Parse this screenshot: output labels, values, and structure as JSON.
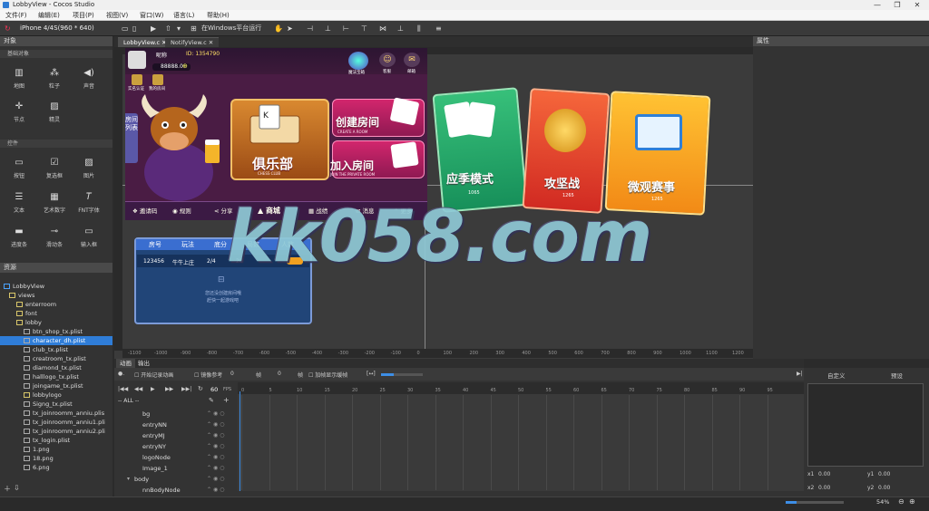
{
  "window": {
    "title": "LobbyView - Cocos Studio",
    "min": "—",
    "max": "❐",
    "close": "✕"
  },
  "menu": [
    "文件(F)",
    "编辑(E)",
    "项目(P)",
    "视图(V)",
    "窗口(W)",
    "语言(L)",
    "帮助(H)"
  ],
  "toolbar": {
    "device": "iPhone 4/4S(960 * 640)",
    "run_label": "在Windows平台运行"
  },
  "panels": {
    "objects": "对象",
    "resources": "资源",
    "properties": "属性"
  },
  "objects": {
    "basic_section": "基础对象",
    "basic": [
      "地图",
      "粒子",
      "声音",
      "节点",
      "精灵"
    ],
    "controls_section": "控件",
    "controls": [
      "按钮",
      "复选框",
      "图片",
      "文本",
      "艺术数字",
      "FNT字体",
      "进度条",
      "滑动条",
      "输入框"
    ]
  },
  "resources": {
    "root": "LobbyView",
    "items": [
      "views",
      "enterroom",
      "font",
      "lobby",
      "btn_shop_tx.plist",
      "character_dh.plist",
      "club_tx.plist",
      "creatroom_tx.plist",
      "diamond_tx.plist",
      "halllogo_tx.plist",
      "joingame_tx.plist",
      "lobbylogo",
      "Signg_tx.plist",
      "tx_joinroomm_anniu.plis",
      "tx_joinroomm_anniu1.pli",
      "tx_joinroomm_anniu2.pli",
      "tx_login.plist",
      "1.png",
      "18.png",
      "6.png"
    ]
  },
  "tabs": [
    "LobbyView.c",
    "NotifyView.c"
  ],
  "ruler_bottom": [
    "-1100",
    "-1000",
    "-900",
    "-800",
    "-700",
    "-600",
    "-500",
    "-400",
    "-300",
    "-200",
    "-100",
    "0",
    "100",
    "200",
    "300",
    "400",
    "500",
    "600",
    "700",
    "800",
    "900",
    "1000",
    "1100",
    "1200"
  ],
  "scene": {
    "player_name": "昵称",
    "player_id": "ID: 1354790",
    "coins": "88888.0",
    "top_icons": [
      "魔法宝箱",
      "客服",
      "邮箱"
    ],
    "left_icons": [
      "实名认证",
      "我的房间"
    ],
    "room_list": "房间列表",
    "club_title": "俱乐部",
    "club_sub": "CHESS CLUB",
    "create_title": "创建房间",
    "create_sub": "CREATE A ROOM",
    "join_title": "加入房间",
    "join_sub": "JOIN THE PRIVATE ROOM",
    "bottom": [
      "邀请码",
      "规则",
      "分享",
      "商城",
      "战绩",
      "消息",
      "更多"
    ]
  },
  "room_table": {
    "headers": [
      "房号",
      "玩法",
      "底分",
      "局数",
      "人数"
    ],
    "row": [
      "123456",
      "牛牛上庄",
      "2/4",
      "20"
    ],
    "empty": "您还没创建房间哦",
    "empty2": "赶快一起游戏吧"
  },
  "modes": [
    {
      "title": "应季模式",
      "count": "1065"
    },
    {
      "title": "攻坚战",
      "count": "1265"
    },
    {
      "title": "微观赛事",
      "count": "1265"
    }
  ],
  "watermark": "kk058.com",
  "anim": {
    "tabs": [
      "动画",
      "输出"
    ],
    "record": "开始记录动画",
    "onion": "镜像参考",
    "labels": [
      "帧",
      "帧"
    ],
    "values": [
      "0",
      "0"
    ],
    "interp": "加帧显示缓帧",
    "filter": "-- ALL --",
    "fps": "60",
    "fps_unit": "FPS",
    "ticks": [
      "0",
      "5",
      "10",
      "15",
      "20",
      "25",
      "30",
      "35",
      "40",
      "45",
      "50",
      "55",
      "60",
      "65",
      "70",
      "75",
      "80",
      "85",
      "90",
      "95"
    ],
    "nodes": [
      "bg",
      "entryNN",
      "entryMJ",
      "entryNY",
      "logoNode",
      "Image_1",
      "body",
      "nnBodyNode"
    ]
  },
  "curve": {
    "custom": "自定义",
    "preset": "预设",
    "x1": "x1",
    "x1v": "0.00",
    "y1": "y1",
    "y1v": "0.00",
    "x2": "x2",
    "x2v": "0.00",
    "y2": "y2",
    "y2v": "0.00"
  },
  "status": {
    "zoom": "54%"
  }
}
